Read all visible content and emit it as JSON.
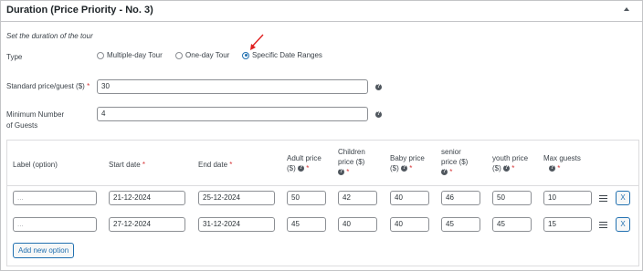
{
  "panel": {
    "title": "Duration (Price Priority - No. 3)"
  },
  "description": "Set the duration of the tour",
  "type_field": {
    "label": "Type",
    "options": [
      "Multiple-day Tour",
      "One-day Tour",
      "Specific Date Ranges"
    ],
    "selected": "Specific Date Ranges"
  },
  "standard_price": {
    "label": "Standard price/guest ($)",
    "required": "*",
    "value": "30"
  },
  "min_guests": {
    "label_line1": "Minimum Number",
    "label_line2": "of Guests",
    "value": "4"
  },
  "table": {
    "headers": {
      "label": "Label (option)",
      "start": "Start date",
      "end": "End date",
      "adult_1": "Adult price",
      "adult_2": "($)",
      "children_1": "Children",
      "children_2": "price ($)",
      "baby_1": "Baby price",
      "baby_2": "($)",
      "senior_1": "senior",
      "senior_2": "price ($)",
      "youth_1": "youth price",
      "youth_2": "($)",
      "max": "Max guests",
      "required": "*",
      "help": "?"
    },
    "rows": [
      {
        "label_placeholder": "...",
        "start": "21-12-2024",
        "end": "25-12-2024",
        "adult": "50",
        "children": "42",
        "baby": "40",
        "senior": "46",
        "youth": "50",
        "max": "10",
        "remove": "X"
      },
      {
        "label_placeholder": "...",
        "start": "27-12-2024",
        "end": "31-12-2024",
        "adult": "45",
        "children": "40",
        "baby": "40",
        "senior": "45",
        "youth": "45",
        "max": "15",
        "remove": "X"
      }
    ],
    "add_button": "Add new option"
  },
  "colors": {
    "accent": "#2271b1",
    "required": "#d63638",
    "annotation_arrow": "#e02020"
  },
  "icons": {
    "collapse": "triangle-up-icon",
    "help": "question-circle-icon",
    "drag": "hamburger-icon",
    "annotation": "red-arrow-icon"
  }
}
